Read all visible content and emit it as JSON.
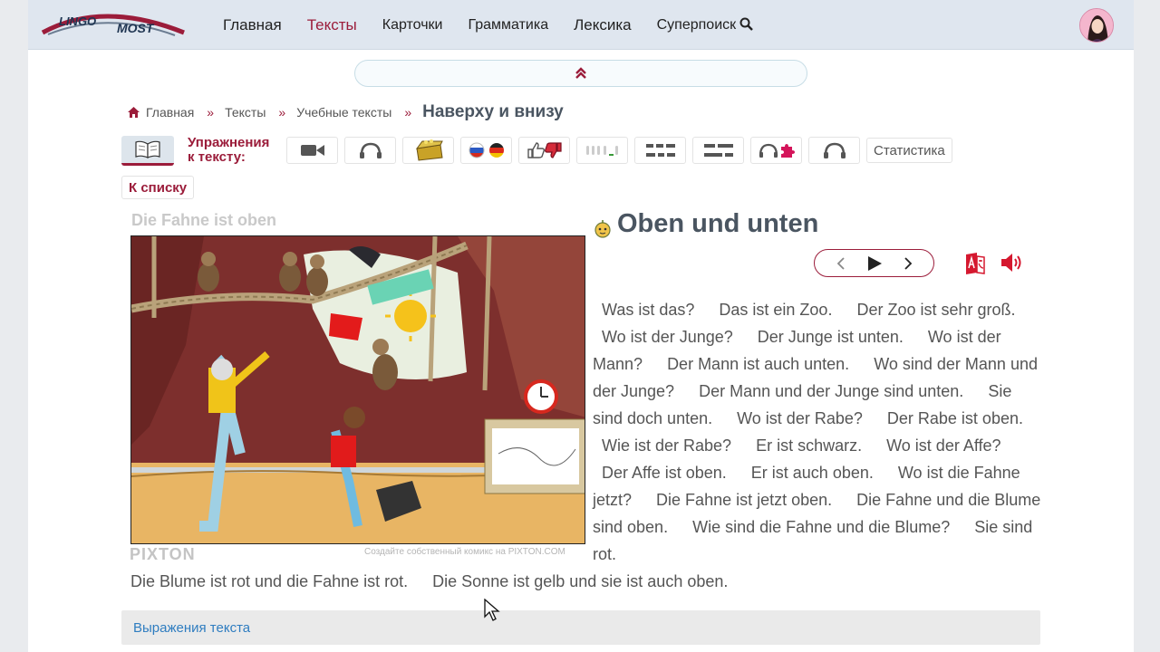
{
  "nav": {
    "logo_top": "LINGO",
    "logo_bottom": "MOST",
    "links": [
      "Главная",
      "Тексты",
      "Карточки",
      "Грамматика",
      "Лексика",
      "Суперпоиск"
    ],
    "active": "Тексты",
    "search_icon": "search-icon",
    "accent": "#9b1c3a"
  },
  "breadcrumb": {
    "home_icon": "home-icon",
    "items": [
      "Главная",
      "Тексты",
      "Учебные тексты"
    ],
    "current": "Наверху и внизу"
  },
  "exercises": {
    "label_line1": "Упражнения",
    "label_line2": "к тексту:",
    "buttons": [
      "video-icon",
      "headphones-icon",
      "treasure-chest-icon",
      "flags-ru-de-icon",
      "thumbs-up-down-icon",
      "sound-bars-icon",
      "word-order-icon",
      "blanks-icon",
      "listen-puzzle-icon",
      "dictation-headphones-icon"
    ],
    "stats_label": "Статистика"
  },
  "to_list": "К списку",
  "comic": {
    "caption": "Die Fahne ist oben",
    "brand": "PIXTON",
    "credit": "Создайте собственный комикс на PIXTON.COM"
  },
  "text": {
    "level_icon": "beginner-level-icon",
    "title": "Oben und unten",
    "sentences_right": [
      "Was ist das?",
      "Das ist ein Zoo.",
      "Der Zoo ist sehr groß.",
      "Wo ist der Junge?",
      "Der Junge ist unten.",
      "Wo ist der Mann?",
      "Der Mann ist auch unten.",
      "Wo sind der Mann und der Junge?",
      "Der Mann und der Junge sind unten.",
      "Sie sind doch unten.",
      "Wo ist der Rabe?",
      "Der Rabe ist oben.",
      "Wie ist der Rabe?",
      "Er ist schwarz.",
      "Wo ist der Affe?",
      "Der Affe ist oben.",
      "Er ist auch oben.",
      "Wo ist die Fahne jetzt?",
      "Die Fahne ist jetzt oben.",
      "Die Fahne und die Blume sind oben.",
      "Wie sind die Fahne und die Blume?",
      "Sie sind rot."
    ],
    "sentences_bottom": [
      "Die Blume ist rot und die Fahne ist rot.",
      "Die Sonne ist gelb und sie ist auch oben."
    ]
  },
  "expressions": "Выражения текста"
}
